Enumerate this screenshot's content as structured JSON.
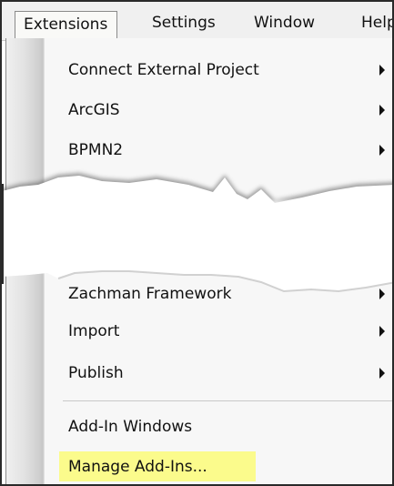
{
  "menubar": {
    "items": [
      {
        "label": "Extensions",
        "active": true
      },
      {
        "label": "Settings",
        "active": false
      },
      {
        "label": "Window",
        "active": false
      },
      {
        "label": "Help",
        "active": false
      }
    ]
  },
  "menu": {
    "items_top": [
      {
        "label": "Connect External Project",
        "submenu": true
      },
      {
        "label": "ArcGIS",
        "submenu": true
      },
      {
        "label": "BPMN2",
        "submenu": true
      }
    ],
    "items_bottom": [
      {
        "label": "Zachman Framework",
        "submenu": true
      },
      {
        "label": "Import",
        "submenu": true
      },
      {
        "label": "Publish",
        "submenu": true
      }
    ],
    "items_after_separator": [
      {
        "label": "Add-In Windows",
        "submenu": false
      },
      {
        "label": "Manage Add-Ins...",
        "submenu": false,
        "highlighted": true
      }
    ]
  },
  "colors": {
    "highlight": "#fbfb8c",
    "menu_background": "#f7f7f7",
    "menubar_background": "#f0f0f0"
  }
}
